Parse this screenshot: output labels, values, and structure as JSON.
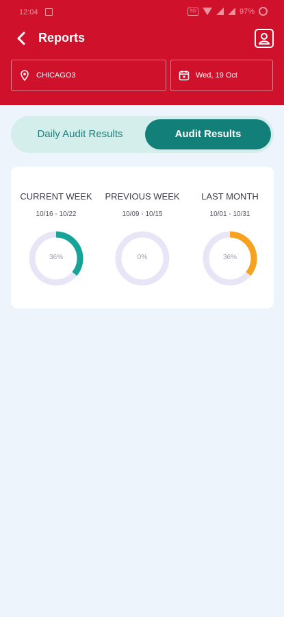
{
  "status_bar": {
    "time": "12:04",
    "network": "5G",
    "battery": "97%"
  },
  "header": {
    "title": "Reports"
  },
  "filters": {
    "location": "CHICAGO3",
    "date": "Wed, 19 Oct"
  },
  "tabs": [
    {
      "label": "Daily Audit Results",
      "active": false
    },
    {
      "label": "Audit Results",
      "active": true
    }
  ],
  "summary": [
    {
      "title": "CURRENT WEEK",
      "range": "10/16 - 10/22",
      "percent_label": "36%",
      "percent": 36,
      "color": "#17a398"
    },
    {
      "title": "PREVIOUS WEEK",
      "range": "10/09 - 10/15",
      "percent_label": "0%",
      "percent": 0,
      "color": "#17a398"
    },
    {
      "title": "LAST MONTH",
      "range": "10/01 - 10/31",
      "percent_label": "36%",
      "percent": 36,
      "color": "#f7a21e"
    }
  ],
  "colors": {
    "header": "#d0112b",
    "accent": "#127f79",
    "ring_track": "#e8e6f6",
    "background": "#eef4fb"
  }
}
